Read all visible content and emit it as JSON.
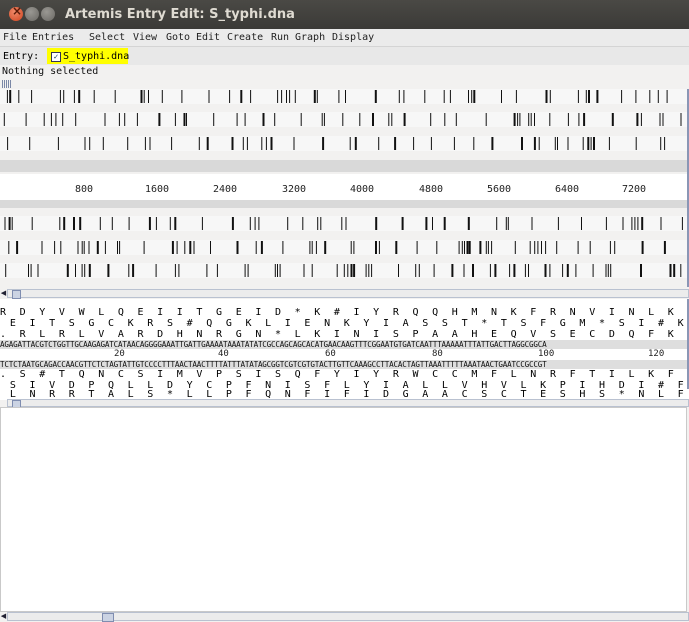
{
  "window": {
    "title": "Artemis Entry Edit: S_typhi.dna"
  },
  "menu": [
    "File",
    "Entries",
    "Select",
    "View",
    "Goto",
    "Edit",
    "Create",
    "Run",
    "Graph",
    "Display"
  ],
  "entry_bar": {
    "label": "Entry:",
    "entry_name": "S_typhi.dna",
    "checked": true
  },
  "status": {
    "text": "Nothing selected"
  },
  "ruler": {
    "ticks": [
      "800",
      "1600",
      "2400",
      "3200",
      "4000",
      "4800",
      "5600",
      "6400",
      "7200"
    ]
  },
  "base_view": {
    "forward_frames": [
      "R D Y V W L Q E I I T G E I D * K # I Y R Q Q H M N K F R N V I N L K I Y * L R R A",
      " E I T S G C K R S # Q G K L I E N K Y I A S S T * T S F G M * S I # K F I D L G G Q",
      ". R L R L V A R D H N R G N * L K I N I S P A A H E Q V S E C D Q F K N L L T + A G"
    ],
    "forward_dna": "AGAGATTACGTCTGGTTGCAAGAGATCATAACAGGGGAAATTGATTGAAAATAAATATATCGCCAGCAGCACATGAACAAGTTTCGGAATGTGATCAATTTAAAAATTTATTGACTTAGGCGGCA",
    "positions": [
      "20",
      "40",
      "60",
      "80",
      "100",
      "120"
    ],
    "reverse_dna": "TCTCTAATGCAGACCAACGTTCTCTAGTATTGTCCCCTTTAACTAACTTTTATTTATATAGCGGTCGTCGTGTACTTGTTCAAAGCCTTACACTAGTTAAATTTTTAAATAACTGAATCCGCCGT",
    "reverse_frames": [
      ". S # T Q N C S I M V P S I S Q F Y I Y R W C C M F L N R F T I L K F I # Q S L R A",
      " S I V D P Q L L D Y C P F N I S F L Y I A L L V H V L K P I H D I # F N I S K P P C",
      " L N R R T A L S * L L P F Q N F I F I D G A A C S C T E S H S * N L F K N V # A P L"
    ]
  },
  "colors": {
    "entry_highlight": "#ffff00",
    "title_bar": "#3c3b37",
    "close_button": "#e05a2f"
  },
  "icons": [
    "close-icon",
    "minimize-icon",
    "maximize-icon",
    "checkbox-checked-icon",
    "scroll-left-icon"
  ]
}
